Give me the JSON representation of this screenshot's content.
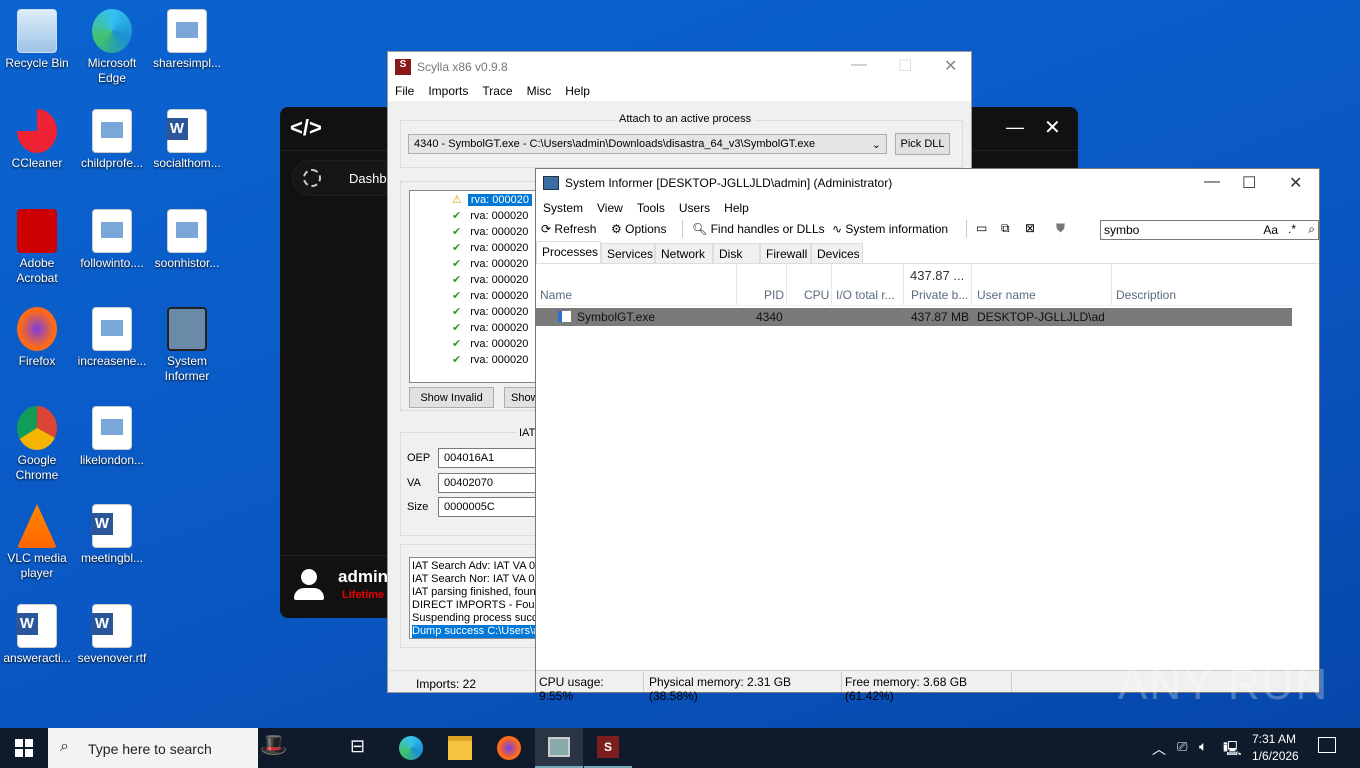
{
  "desktop": {
    "icons": [
      {
        "label": "Recycle Bin"
      },
      {
        "label": "Microsoft Edge"
      },
      {
        "label": "sharesimpl..."
      },
      {
        "label": "CCleaner"
      },
      {
        "label": "childprofe..."
      },
      {
        "label": "socialthom..."
      },
      {
        "label": "Adobe Acrobat"
      },
      {
        "label": "followinto...."
      },
      {
        "label": "soonhistor..."
      },
      {
        "label": "Firefox"
      },
      {
        "label": "increasene..."
      },
      {
        "label": "System Informer"
      },
      {
        "label": "Google Chrome"
      },
      {
        "label": "likelondon..."
      },
      {
        "label": "VLC media player"
      },
      {
        "label": "meetingbl..."
      },
      {
        "label": "answeracti..."
      },
      {
        "label": "sevenover.rtf"
      }
    ]
  },
  "darkapp": {
    "nav_item": "Dashboard",
    "user_name": "admin",
    "plan": "Lifetime"
  },
  "scylla": {
    "title": "Scylla x86 v0.9.8",
    "menu": [
      "File",
      "Imports",
      "Trace",
      "Misc",
      "Help"
    ],
    "attach_label": "Attach to an active process",
    "process_selected": "4340 - SymbolGT.exe - C:\\Users\\admin\\Downloads\\disastra_64_v3\\SymbolGT.exe",
    "pick_dll": "Pick DLL",
    "tree_items": [
      "rva: 000020",
      "rva: 000020",
      "rva: 000020",
      "rva: 000020",
      "rva: 000020",
      "rva: 000020",
      "rva: 000020",
      "rva: 000020",
      "rva: 000020",
      "rva: 000020",
      "rva: 000020"
    ],
    "show_invalid": "Show Invalid",
    "show_suspect": "Show",
    "iat_label": "IAT",
    "oep_label": "OEP",
    "oep": "004016A1",
    "va_label": "VA",
    "va": "00402070",
    "size_label": "Size",
    "size": "0000005C",
    "log": [
      "IAT Search Adv: IAT VA 0",
      "IAT Search Nor: IAT VA 0",
      "IAT parsing finished, foun",
      "DIRECT IMPORTS - Found",
      "Suspending process succe",
      "Dump success C:\\Users\\a"
    ],
    "status_imports": "Imports: 22"
  },
  "sysinformer": {
    "title": "System Informer [DESKTOP-JGLLJLD\\admin] (Administrator)",
    "menu": [
      "System",
      "View",
      "Tools",
      "Users",
      "Help"
    ],
    "toolbar": {
      "refresh": "Refresh",
      "options": "Options",
      "find": "Find handles or DLLs",
      "sysinfo": "System information"
    },
    "search_value": "symbo",
    "search_opts": "Aa",
    "tabs": [
      "Processes",
      "Services",
      "Network",
      "Disk",
      "Firewall",
      "Devices"
    ],
    "columns": {
      "name": "Name",
      "pid": "PID",
      "cpu": "CPU",
      "io": "I/O total r...",
      "private": "Private b...",
      "private_total": "437.87 ...",
      "user": "User name",
      "desc": "Description"
    },
    "rows": [
      {
        "name": "SymbolGT.exe",
        "pid": "4340",
        "private": "437.87 MB",
        "user": "DESKTOP-JGLLJLD\\admi"
      }
    ],
    "status": {
      "cpu": "CPU usage: 9.55%",
      "phys": "Physical memory: 2.31 GB (38.58%)",
      "free": "Free memory: 3.68 GB (61.42%)"
    }
  },
  "taskbar": {
    "search_placeholder": "Type here to search",
    "time": "7:31 AM",
    "date": "1/6/2026"
  },
  "watermark": "ANY RUN"
}
